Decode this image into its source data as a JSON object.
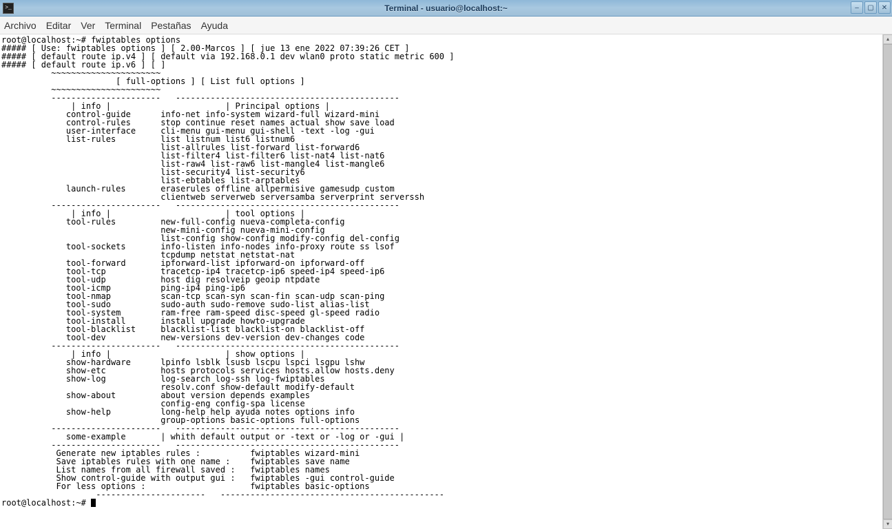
{
  "window": {
    "title": "Terminal - usuario@localhost:~"
  },
  "menubar": {
    "items": [
      "Archivo",
      "Editar",
      "Ver",
      "Terminal",
      "Pestañas",
      "Ayuda"
    ]
  },
  "prompt": "root@localhost:~#",
  "command": "fwiptables options",
  "header": {
    "line1": "##### [ Use: fwiptables options ] [ 2.00-Marcos ] [ jue 13 ene 2022 07:39:26 CET ]",
    "line2": "##### [ default route ip.v4 ] [ default via 192.168.0.1 dev wlan0 proto static metric 600 ]",
    "line3": "##### [ default route ip.v6 ] [ ]"
  },
  "sections": {
    "full_options_hdr": "                       [ full-options ] [ List full options ]",
    "div1": "          ----------------------   ---------------------------------------------",
    "principal": {
      "hdr": "              | info |                       | Principal options |",
      "rows": [
        "             control-guide      info-net info-system wizard-full wizard-mini",
        "             control-rules      stop continue reset names actual show save load",
        "             user-interface     cli-menu gui-menu gui-shell -text -log -gui",
        "             list-rules         list listnum list6 listnum6",
        "                                list-allrules list-forward list-forward6",
        "                                list-filter4 list-filter6 list-nat4 list-nat6",
        "                                list-raw4 list-raw6 list-mangle4 list-mangle6",
        "                                list-security4 list-security6",
        "                                list-ebtables list-arptables",
        "             launch-rules       eraserules offline allpermisive gamesudp custom",
        "                                clientweb serverweb serversamba serverprint serverssh"
      ]
    },
    "tool": {
      "hdr": "              | info |                       | tool options |",
      "rows": [
        "             tool-rules         new-full-config nueva-completa-config",
        "                                new-mini-config nueva-mini-config",
        "                                list-config show-config modify-config del-config",
        "             tool-sockets       info-listen info-nodes info-proxy route ss lsof",
        "                                tcpdump netstat netstat-nat",
        "             tool-forward       ipforward-list ipforward-on ipforward-off",
        "             tool-tcp           tracetcp-ip4 tracetcp-ip6 speed-ip4 speed-ip6",
        "             tool-udp           host dig resolveip geoip ntpdate",
        "             tool-icmp          ping-ip4 ping-ip6",
        "             tool-nmap          scan-tcp scan-syn scan-fin scan-udp scan-ping",
        "             tool-sudo          sudo-auth sudo-remove sudo-list alias-list",
        "             tool-system        ram-free ram-speed disc-speed gl-speed radio",
        "             tool-install       install upgrade howto-upgrade",
        "             tool-blacklist     blacklist-list blacklist-on blacklist-off",
        "             tool-dev           new-versions dev-version dev-changes code"
      ]
    },
    "show": {
      "hdr": "              | info |                       | show options |",
      "rows": [
        "             show-hardware      lpinfo lsblk lsusb lscpu lspci lsgpu lshw",
        "             show-etc           hosts protocols services hosts.allow hosts.deny",
        "             show-log           log-search log-ssh log-fwiptables",
        "                                resolv.conf show-default modify-default",
        "             show-about         about version depends examples",
        "                                config-eng config-spa license",
        "             show-help          long-help help ayuda notes options info",
        "                                group-options basic-options full-options"
      ]
    },
    "example": {
      "hdr": "             some-example       | whith default output or -text or -log or -gui |",
      "rows": [
        "           Generate new iptables rules :          fwiptables wizard-mini",
        "           Save iptables rules with one name :    fwiptables save name",
        "           List names from all firewall saved :   fwiptables names",
        "           Show control-guide with output gui :   fwiptables -gui control-guide",
        "           For less options :                     fwiptables basic-options"
      ]
    },
    "bottomdiv": "                   ----------------------   ---------------------------------------------"
  },
  "final_prompt": "root@localhost:~# "
}
